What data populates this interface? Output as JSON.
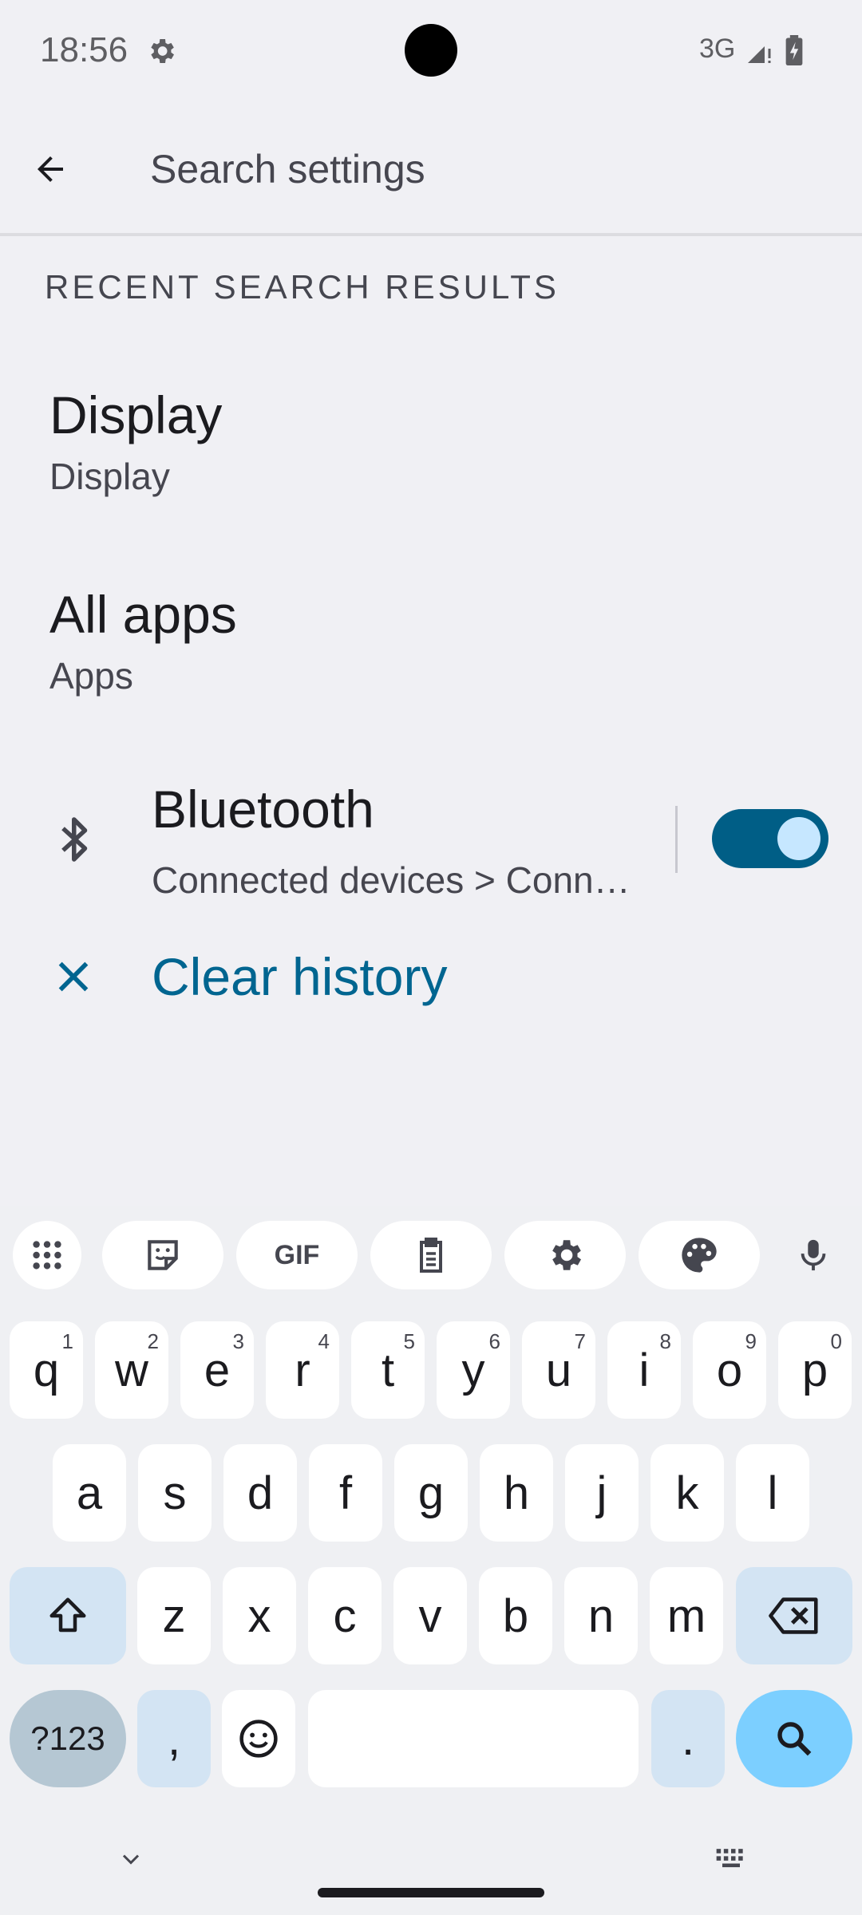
{
  "status_bar": {
    "time": "18:56",
    "network": "3G"
  },
  "search": {
    "placeholder": "Search settings",
    "value": ""
  },
  "recent": {
    "header": "RECENT SEARCH RESULTS",
    "items": [
      {
        "title": "Display",
        "subtitle": "Display"
      },
      {
        "title": "All apps",
        "subtitle": "Apps"
      }
    ],
    "bluetooth": {
      "title": "Bluetooth",
      "subtitle": "Connected devices > Connection preferences",
      "toggle_on": true
    },
    "clear_label": "Clear history"
  },
  "keyboard": {
    "row1": [
      {
        "key": "q",
        "hint": "1"
      },
      {
        "key": "w",
        "hint": "2"
      },
      {
        "key": "e",
        "hint": "3"
      },
      {
        "key": "r",
        "hint": "4"
      },
      {
        "key": "t",
        "hint": "5"
      },
      {
        "key": "y",
        "hint": "6"
      },
      {
        "key": "u",
        "hint": "7"
      },
      {
        "key": "i",
        "hint": "8"
      },
      {
        "key": "o",
        "hint": "9"
      },
      {
        "key": "p",
        "hint": "0"
      }
    ],
    "row2": [
      "a",
      "s",
      "d",
      "f",
      "g",
      "h",
      "j",
      "k",
      "l"
    ],
    "row3": [
      "z",
      "x",
      "c",
      "v",
      "b",
      "n",
      "m"
    ],
    "symbols_label": "?123",
    "comma": ",",
    "period": ".",
    "gif_label": "GIF"
  },
  "colors": {
    "accent": "#006590",
    "toggle_track": "#005E86",
    "toggle_thumb": "#C6E7FF",
    "search_key": "#7CCFFF"
  }
}
